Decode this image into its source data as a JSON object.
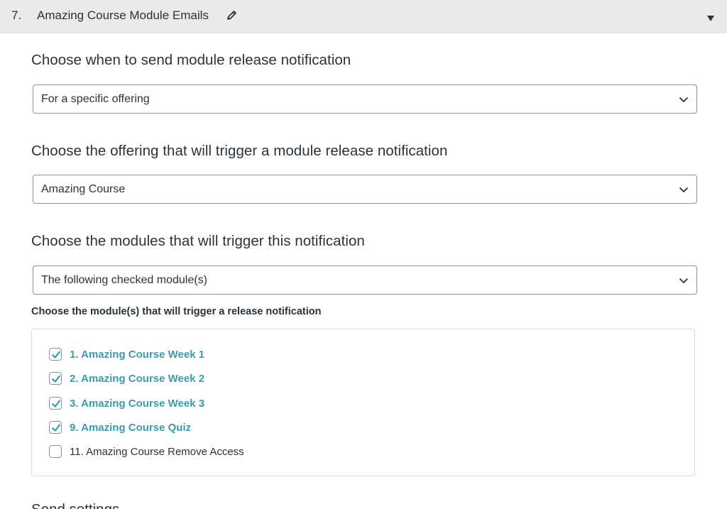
{
  "section": {
    "number": "7.",
    "title": "Amazing Course Module Emails",
    "edit_icon": "pencil-icon",
    "toggle_icon": "caret-down-icon"
  },
  "fields": {
    "send_when": {
      "label": "Choose when to send module release notification",
      "value": "For a specific offering"
    },
    "offering": {
      "label": "Choose the offering that will trigger a module release notification",
      "value": "Amazing Course"
    },
    "modules_mode": {
      "label": "Choose the modules that will trigger this notification",
      "value": "The following checked module(s)"
    }
  },
  "module_picker": {
    "label": "Choose the module(s) that will trigger a release notification",
    "items": [
      {
        "label": "1. Amazing Course Week 1",
        "checked": true
      },
      {
        "label": "2. Amazing Course Week 2",
        "checked": true
      },
      {
        "label": "3. Amazing Course Week 3",
        "checked": true
      },
      {
        "label": "9. Amazing Course Quiz",
        "checked": true
      },
      {
        "label": "11. Amazing Course Remove Access",
        "checked": false
      }
    ]
  },
  "next_section_label": "Send settings",
  "colors": {
    "header_bg": "#e9eaec",
    "accent": "#3a9bb0",
    "text": "#2c3338",
    "border": "#8c8f94"
  }
}
